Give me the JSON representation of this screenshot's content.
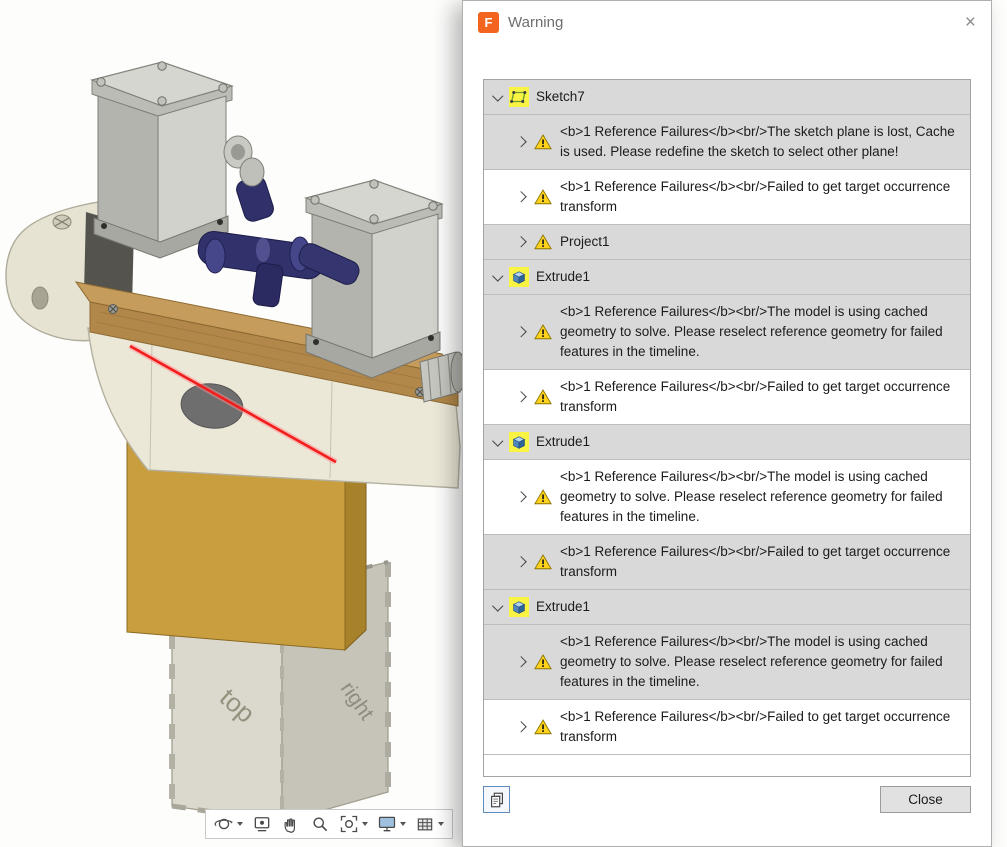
{
  "window": {
    "logo_letter": "F",
    "title": "Warning",
    "close_glyph": "×"
  },
  "warning_list": {
    "close_button": "Close",
    "rows": [
      {
        "kind": "header",
        "icon": "sketch",
        "expanded": true,
        "label": "Sketch7",
        "bg": "gray"
      },
      {
        "kind": "warning",
        "icon": "warning",
        "expanded": false,
        "text": "<b>1 Reference Failures</b><br/>The sketch plane is lost, Cache is used. Please redefine the sketch to select other plane!",
        "bg": "gray"
      },
      {
        "kind": "warning",
        "icon": "warning",
        "expanded": false,
        "text": "<b>1 Reference Failures</b><br/>Failed to get target occurrence transform",
        "bg": "white"
      },
      {
        "kind": "feature",
        "icon": "warning",
        "expanded": false,
        "label": "Project1",
        "bg": "gray"
      },
      {
        "kind": "header",
        "icon": "extrude",
        "expanded": true,
        "label": "Extrude1",
        "bg": "gray"
      },
      {
        "kind": "warning",
        "icon": "warning",
        "expanded": false,
        "text": "<b>1 Reference Failures</b><br/>The model is using cached geometry to solve. Please reselect reference geometry for failed features in the timeline.",
        "bg": "gray"
      },
      {
        "kind": "warning",
        "icon": "warning",
        "expanded": false,
        "text": "<b>1 Reference Failures</b><br/>Failed to get target occurrence transform",
        "bg": "white"
      },
      {
        "kind": "header",
        "icon": "extrude",
        "expanded": true,
        "label": "Extrude1",
        "bg": "gray"
      },
      {
        "kind": "warning",
        "icon": "warning",
        "expanded": false,
        "text": "<b>1 Reference Failures</b><br/>The model is using cached geometry to solve. Please reselect reference geometry for failed features in the timeline.",
        "bg": "white"
      },
      {
        "kind": "warning",
        "icon": "warning",
        "expanded": false,
        "text": "<b>1 Reference Failures</b><br/>Failed to get target occurrence transform",
        "bg": "gray"
      },
      {
        "kind": "header",
        "icon": "extrude",
        "expanded": true,
        "label": "Extrude1",
        "bg": "gray"
      },
      {
        "kind": "warning",
        "icon": "warning",
        "expanded": false,
        "text": "<b>1 Reference Failures</b><br/>The model is using cached geometry to solve. Please reselect reference geometry for failed features in the timeline.",
        "bg": "gray"
      },
      {
        "kind": "warning",
        "icon": "warning",
        "expanded": false,
        "text": "<b>1 Reference Failures</b><br/>Failed to get target occurrence transform",
        "bg": "white"
      }
    ]
  },
  "viewport": {
    "engravings": {
      "left_face": "top",
      "right_face": "right"
    },
    "toolbar": [
      {
        "name": "orbit",
        "caret": true
      },
      {
        "name": "look-at",
        "caret": false
      },
      {
        "name": "pan",
        "caret": false
      },
      {
        "name": "zoom",
        "caret": false
      },
      {
        "name": "fit",
        "caret": true
      },
      {
        "name": "display-settings",
        "caret": true
      },
      {
        "name": "grid-settings",
        "caret": true
      }
    ]
  },
  "colors": {
    "row_alt_gray": "#d9d9d9",
    "icon_highlight_yellow": "#f9f344",
    "warning_triangle_yellow": "#ffd21e",
    "logo_orange": "#f3641e"
  }
}
